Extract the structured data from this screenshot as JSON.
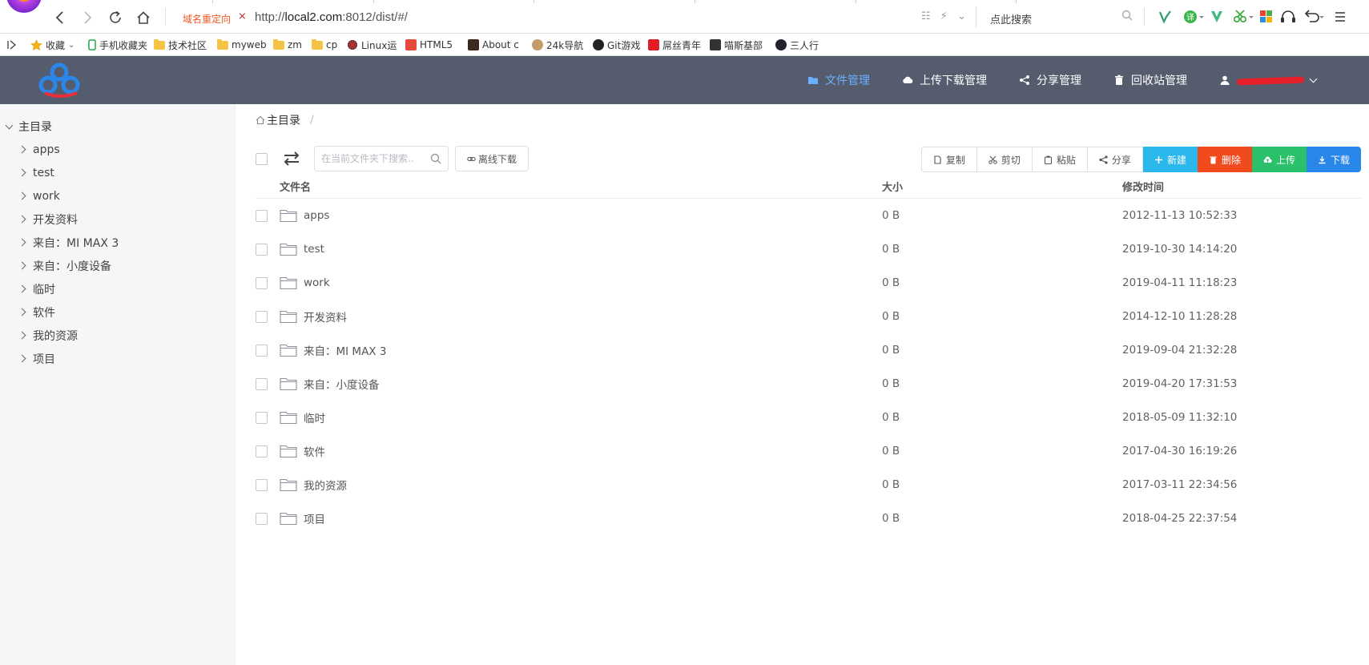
{
  "browser": {
    "redirect_label": "域名重定向",
    "url_prefix": "http://",
    "url_host": "local2.com",
    "url_rest": ":8012/dist/#/",
    "search_label": "点此搜索"
  },
  "bookmarks": [
    {
      "label": "收藏",
      "icon": "star-icon"
    },
    {
      "label": "手机收藏夹",
      "icon": "phone-icon"
    },
    {
      "label": "技术社区",
      "icon": "folder-icon"
    },
    {
      "label": "myweb",
      "icon": "folder-icon"
    },
    {
      "label": "zm",
      "icon": "folder-icon"
    },
    {
      "label": "cp",
      "icon": "folder-icon"
    },
    {
      "label": "Linux运",
      "icon": "linux-icon"
    },
    {
      "label": "HTML5",
      "icon": "html5-icon"
    },
    {
      "label": "About c",
      "icon": "about-icon"
    },
    {
      "label": "24k导航",
      "icon": "dog-icon"
    },
    {
      "label": "Git游戏",
      "icon": "github-icon"
    },
    {
      "label": "屌丝青年",
      "icon": "ds-icon"
    },
    {
      "label": "喵斯基部",
      "icon": "m-icon"
    },
    {
      "label": "三人行",
      "icon": "srx-icon"
    }
  ],
  "header": {
    "nav": [
      {
        "label": "文件管理",
        "icon": "folder-icon",
        "active": true
      },
      {
        "label": "上传下载管理",
        "icon": "cloud-icon",
        "active": false
      },
      {
        "label": "分享管理",
        "icon": "share-icon",
        "active": false
      },
      {
        "label": "回收站管理",
        "icon": "trash-icon",
        "active": false
      }
    ]
  },
  "sidebar": {
    "root": "主目录",
    "items": [
      "apps",
      "test",
      "work",
      "开发资料",
      "来自：MI MAX 3",
      "来自：小度设备",
      "临时",
      "软件",
      "我的资源",
      "项目"
    ]
  },
  "main": {
    "breadcrumb": {
      "root": "主目录",
      "sep": "/"
    },
    "search_placeholder": "在当前文件夹下搜索..",
    "offline_label": "离线下载",
    "actions": {
      "copy": "复制",
      "cut": "剪切",
      "paste": "粘贴",
      "share": "分享",
      "new": "新建",
      "delete": "删除",
      "upload": "上传",
      "download": "下载"
    },
    "colors": {
      "new": "#2ab7ec",
      "delete": "#f04a1d",
      "upload": "#2bc06a",
      "download": "#2a87ea"
    },
    "columns": {
      "name": "文件名",
      "size": "大小",
      "time": "修改时间"
    },
    "rows": [
      {
        "name": "apps",
        "size": "0 B",
        "time": "2012-11-13 10:52:33"
      },
      {
        "name": "test",
        "size": "0 B",
        "time": "2019-10-30 14:14:20"
      },
      {
        "name": "work",
        "size": "0 B",
        "time": "2019-04-11 11:18:23"
      },
      {
        "name": "开发资料",
        "size": "0 B",
        "time": "2014-12-10 11:28:28"
      },
      {
        "name": "来自：MI MAX 3",
        "size": "0 B",
        "time": "2019-09-04 21:32:28"
      },
      {
        "name": "来自：小度设备",
        "size": "0 B",
        "time": "2019-04-20 17:31:53"
      },
      {
        "name": "临时",
        "size": "0 B",
        "time": "2018-05-09 11:32:10"
      },
      {
        "name": "软件",
        "size": "0 B",
        "time": "2017-04-30 16:19:26"
      },
      {
        "name": "我的资源",
        "size": "0 B",
        "time": "2017-03-11 22:34:56"
      },
      {
        "name": "项目",
        "size": "0 B",
        "time": "2018-04-25 22:37:54"
      }
    ]
  }
}
